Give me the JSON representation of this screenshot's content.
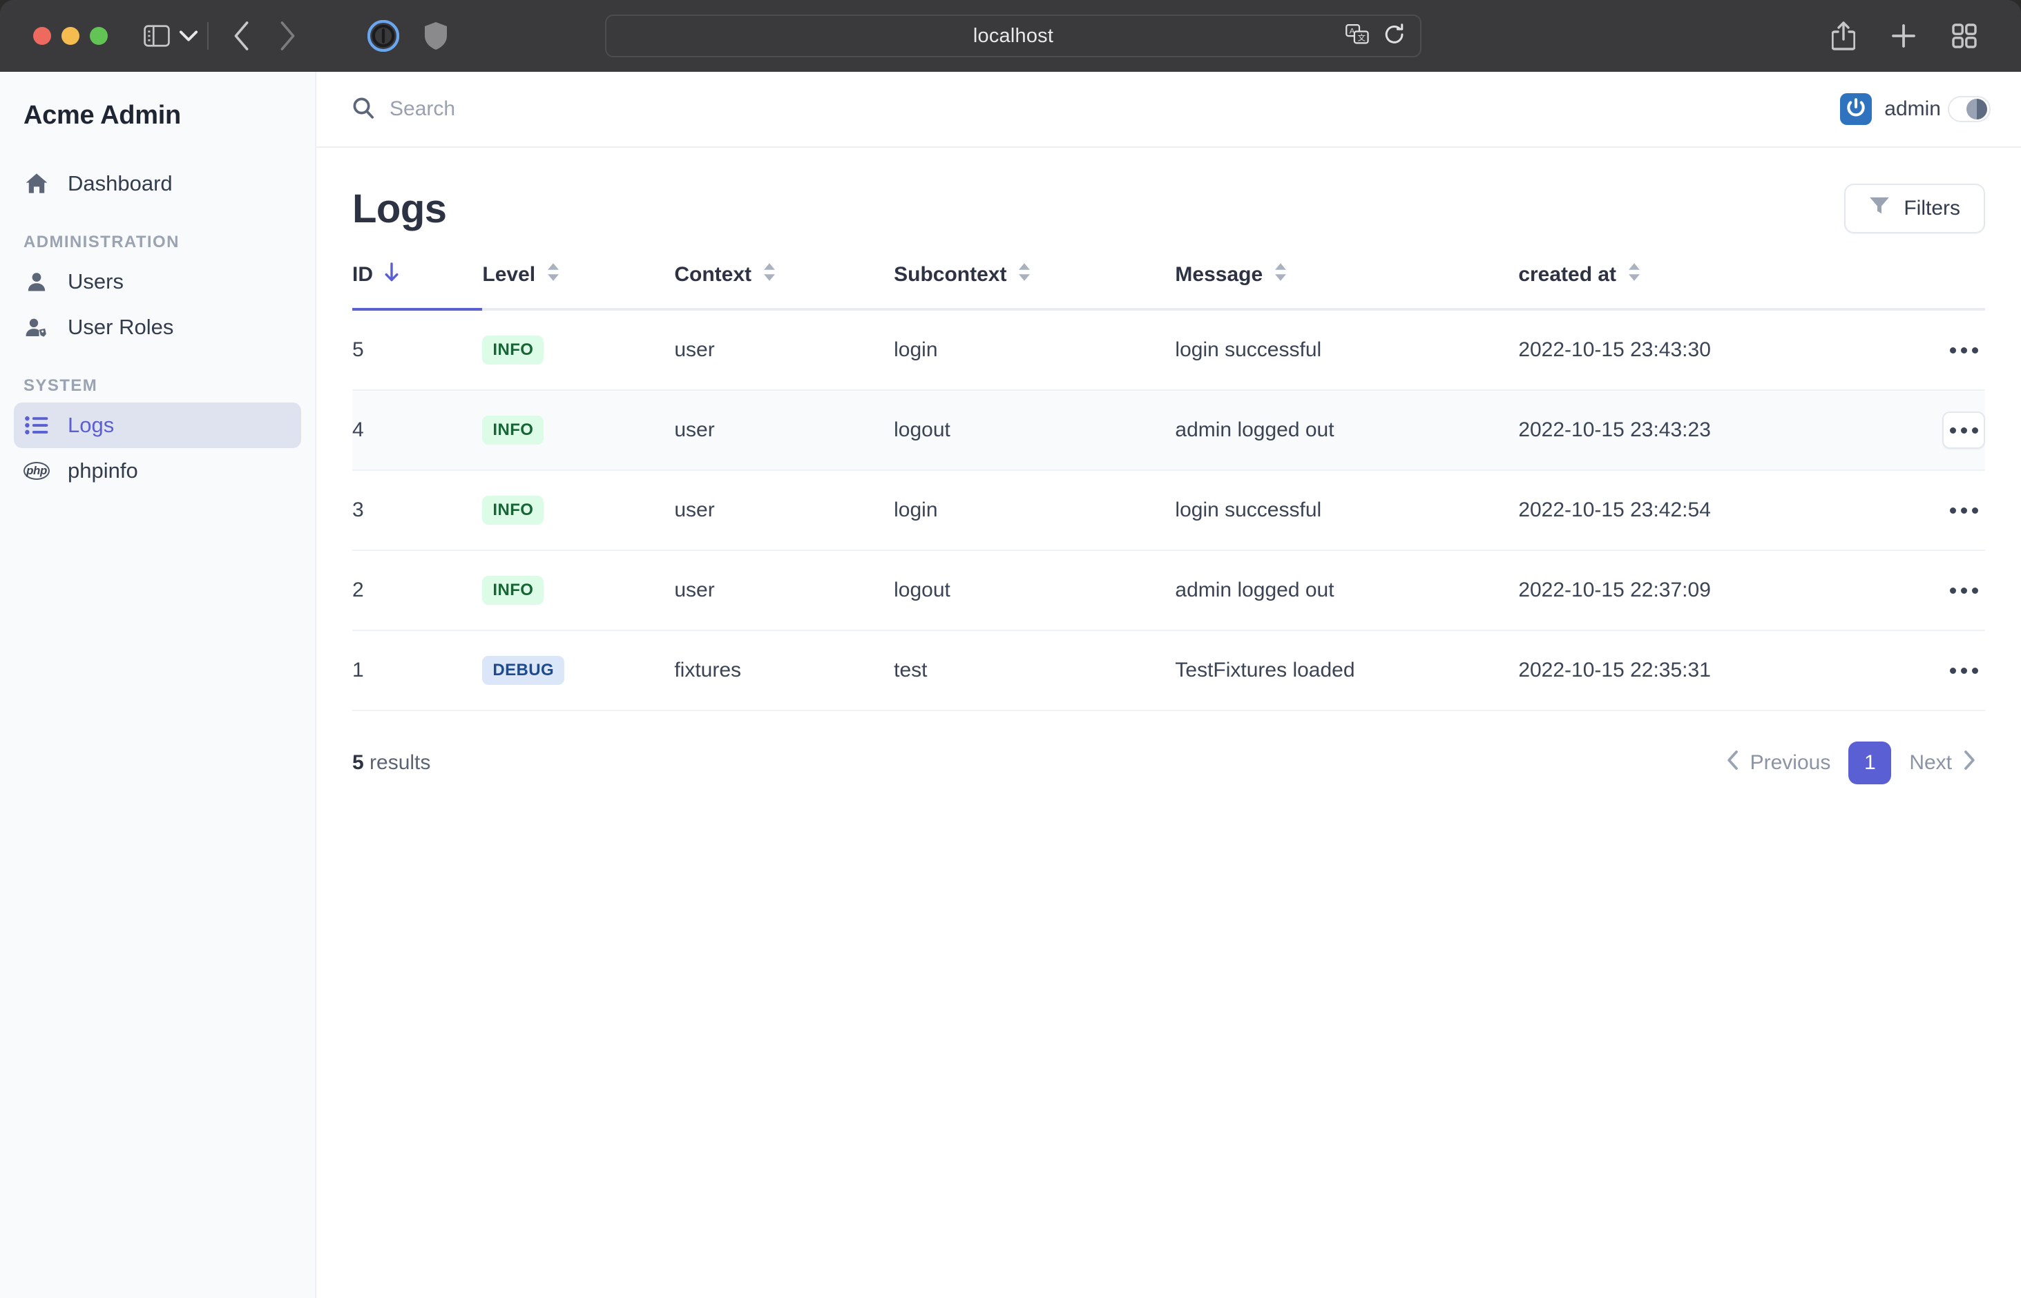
{
  "browser": {
    "url": "localhost",
    "icons": {
      "sidebar_toggle": "sidebar-toggle-icon",
      "tab_dropdown": "chevron-down-icon",
      "back": "back-arrow-icon",
      "forward": "forward-arrow-icon",
      "onepassword": "onepassword-icon",
      "shield": "privacy-shield-icon",
      "translate": "translate-icon",
      "reload": "reload-icon",
      "share": "share-icon",
      "new_tab": "plus-icon",
      "tab_overview": "tab-overview-icon"
    }
  },
  "sidebar": {
    "brand": "Acme Admin",
    "items": [
      {
        "label": "Dashboard",
        "icon": "home-icon",
        "active": false
      },
      {
        "label": "Users",
        "icon": "user-icon",
        "active": false
      },
      {
        "label": "User Roles",
        "icon": "user-tag-icon",
        "active": false
      },
      {
        "label": "Logs",
        "icon": "list-icon",
        "active": true
      },
      {
        "label": "phpinfo",
        "icon": "php-icon",
        "active": false
      }
    ],
    "sections": {
      "administration": "ADMINISTRATION",
      "system": "SYSTEM"
    }
  },
  "topbar": {
    "search_placeholder": "Search",
    "search_value": "",
    "user_name": "admin",
    "avatar_icon": "power-icon",
    "theme_toggle_icon": "half-circle-icon"
  },
  "page": {
    "title": "Logs",
    "filters_label": "Filters",
    "filters_icon": "funnel-icon"
  },
  "table": {
    "columns": [
      {
        "label": "ID",
        "sort": "desc"
      },
      {
        "label": "Level",
        "sort": "none"
      },
      {
        "label": "Context",
        "sort": "none"
      },
      {
        "label": "Subcontext",
        "sort": "none"
      },
      {
        "label": "Message",
        "sort": "none"
      },
      {
        "label": "created at",
        "sort": "none"
      }
    ],
    "rows": [
      {
        "id": "5",
        "level": "INFO",
        "level_kind": "info",
        "context": "user",
        "subcontext": "login",
        "message": "login successful",
        "created_at": "2022-10-15 23:43:30",
        "hovered": false
      },
      {
        "id": "4",
        "level": "INFO",
        "level_kind": "info",
        "context": "user",
        "subcontext": "logout",
        "message": "admin logged out",
        "created_at": "2022-10-15 23:43:23",
        "hovered": true
      },
      {
        "id": "3",
        "level": "INFO",
        "level_kind": "info",
        "context": "user",
        "subcontext": "login",
        "message": "login successful",
        "created_at": "2022-10-15 23:42:54",
        "hovered": false
      },
      {
        "id": "2",
        "level": "INFO",
        "level_kind": "info",
        "context": "user",
        "subcontext": "logout",
        "message": "admin logged out",
        "created_at": "2022-10-15 22:37:09",
        "hovered": false
      },
      {
        "id": "1",
        "level": "DEBUG",
        "level_kind": "debug",
        "context": "fixtures",
        "subcontext": "test",
        "message": "TestFixtures loaded",
        "created_at": "2022-10-15 22:35:31",
        "hovered": false
      }
    ],
    "row_action_icon": "ellipsis-icon"
  },
  "footer": {
    "results_count": "5",
    "results_label": "results",
    "previous_label": "Previous",
    "next_label": "Next",
    "current_page": "1"
  },
  "colors": {
    "accent": "#5a5fd4",
    "info_bg": "#dcfce8",
    "info_fg": "#166534",
    "debug_bg": "#dbe7f8",
    "debug_fg": "#1e4b8f",
    "sidebar_bg": "#f8fafc",
    "active_item_bg": "#dfe3ef"
  }
}
